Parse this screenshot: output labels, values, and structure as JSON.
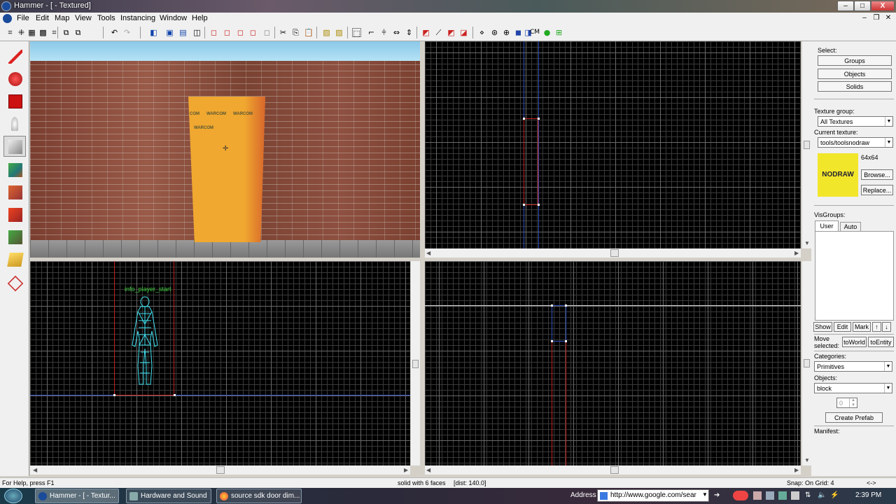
{
  "window": {
    "title": "Hammer - [ - Textured]",
    "min": "–",
    "max": "□",
    "close": "X"
  },
  "menu": [
    "File",
    "Edit",
    "Map",
    "View",
    "Tools",
    "Instancing",
    "Window",
    "Help"
  ],
  "viewports": {
    "camera_3d": {
      "texture_word": "WARCOM",
      "texture_row": [
        "COM",
        "WARCOM",
        "WARCOM"
      ]
    },
    "side": {
      "entity_label": "info_player_start"
    }
  },
  "right_panel": {
    "select_label": "Select:",
    "select_buttons": [
      "Groups",
      "Objects",
      "Solids"
    ],
    "texture_group_label": "Texture group:",
    "texture_group_value": "All Textures",
    "current_texture_label": "Current texture:",
    "current_texture_value": "tools/toolsnodraw",
    "texture_preview_text": "NODRAW",
    "texture_size": "64x64",
    "browse_button": "Browse...",
    "replace_button": "Replace...",
    "visgroups_label": "VisGroups:",
    "visgroup_tabs": [
      "User",
      "Auto"
    ],
    "show_button": "Show",
    "edit_button": "Edit",
    "mark_button": "Mark",
    "up_button": "↑",
    "down_button": "↓",
    "move_selected_label": "Move selected:",
    "to_world_button": "toWorld",
    "to_entity_button": "toEntity",
    "categories_label": "Categories:",
    "categories_value": "Primitives",
    "objects_label": "Objects:",
    "objects_value": "block",
    "stepper_value": "0",
    "create_prefab_button": "Create Prefab",
    "manifest_label": "Manifest:"
  },
  "status": {
    "help": "For Help, press F1",
    "selection": "solid with 6 faces",
    "dist": "[dist: 140.0]",
    "snap": "Snap: On Grid: 4",
    "arrows": "<->"
  },
  "taskbar": {
    "tasks": [
      "Hammer - [ - Textur...",
      "Hardware and Sound",
      "source sdk door dim..."
    ],
    "address_label": "Address",
    "address_value": "http://www.google.com/sear",
    "clock": "2:39 PM"
  },
  "colors": {
    "brick": "#8a4a3a",
    "sky": "#a8d8f0",
    "door_texture": "#f0a830",
    "nodraw_yellow": "#f2e62a",
    "selection_red": "#c02020",
    "entity_cyan": "#40e0f0"
  }
}
